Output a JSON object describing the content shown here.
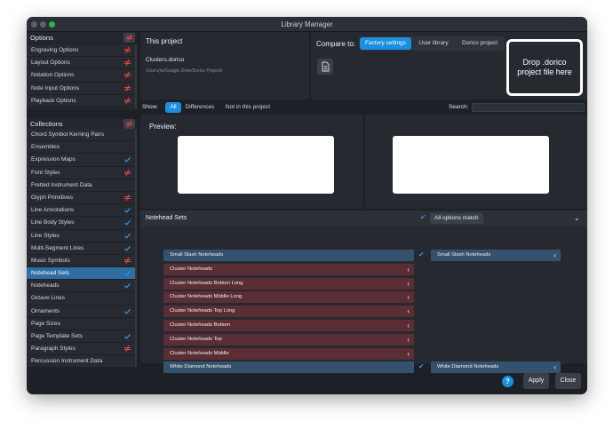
{
  "window": {
    "title": "Library Manager"
  },
  "options": {
    "title": "Options",
    "items": [
      {
        "label": "Engraving Options",
        "status": "diff"
      },
      {
        "label": "Layout Options",
        "status": "diff"
      },
      {
        "label": "Notation Options",
        "status": "diff"
      },
      {
        "label": "Note Input Options",
        "status": "diff"
      },
      {
        "label": "Playback Options",
        "status": "diff"
      }
    ]
  },
  "collections": {
    "title": "Collections",
    "items": [
      {
        "label": "Chord Symbol Kerning Pairs",
        "status": ""
      },
      {
        "label": "Ensembles",
        "status": ""
      },
      {
        "label": "Expression Maps",
        "status": "match"
      },
      {
        "label": "Font Styles",
        "status": "diff"
      },
      {
        "label": "Fretted Instrument Data",
        "status": ""
      },
      {
        "label": "Glyph Primitives",
        "status": "diff"
      },
      {
        "label": "Line Annotations",
        "status": "match"
      },
      {
        "label": "Line Body Styles",
        "status": "match"
      },
      {
        "label": "Line Styles",
        "status": "match"
      },
      {
        "label": "Multi-Segment Lines",
        "status": "match"
      },
      {
        "label": "Music Symbols",
        "status": "diff"
      },
      {
        "label": "Notehead Sets",
        "status": "match",
        "selected": true
      },
      {
        "label": "Noteheads",
        "status": "match"
      },
      {
        "label": "Octave Lines",
        "status": ""
      },
      {
        "label": "Ornaments",
        "status": "match"
      },
      {
        "label": "Page Sizes",
        "status": ""
      },
      {
        "label": "Page Template Sets",
        "status": "match"
      },
      {
        "label": "Paragraph Styles",
        "status": "diff"
      },
      {
        "label": "Percussion Instrument Data",
        "status": ""
      }
    ]
  },
  "project": {
    "title": "This project",
    "filename": "Clusters.dorico",
    "path": "/Users/jw/Google Drive/Dorico Projects"
  },
  "compare": {
    "label": "Compare to:",
    "options": [
      "Factory settings",
      "User library",
      "Dorico project"
    ],
    "active": 0
  },
  "drop": {
    "line1": "Drop .dorico",
    "line2": "project file here"
  },
  "filter": {
    "show_label": "Show:",
    "options": [
      "All",
      "Differences",
      "Not in this project"
    ],
    "active": 0,
    "search_label": "Search:",
    "search_value": ""
  },
  "preview": {
    "label": "Preview:"
  },
  "diff": {
    "section_title": "Notehead Sets",
    "match_label": "All options match",
    "left_items": [
      {
        "label": "Small Slash Noteheads",
        "kind": "blue",
        "tick": true
      },
      {
        "label": "Cluster Noteheads",
        "kind": "red",
        "tick": false
      },
      {
        "label": "Cluster Noteheads Bottom Long",
        "kind": "red",
        "tick": false
      },
      {
        "label": "Cluster Noteheads Middle Long",
        "kind": "red",
        "tick": false
      },
      {
        "label": "Cluster Noteheads Top Long",
        "kind": "red",
        "tick": false
      },
      {
        "label": "Cluster Noteheads Bottom",
        "kind": "red",
        "tick": false
      },
      {
        "label": "Cluster Noteheads Top",
        "kind": "red",
        "tick": false
      },
      {
        "label": "Cluster Noteheads Middle",
        "kind": "red",
        "tick": false
      },
      {
        "label": "White Diamond Noteheads",
        "kind": "blue",
        "tick": true
      }
    ],
    "right_items": [
      {
        "label": "Small Slash Noteheads",
        "row": 0
      },
      {
        "label": "White Diamond Noteheads",
        "row": 8
      }
    ]
  },
  "footer": {
    "help": "?",
    "apply": "Apply",
    "close": "Close"
  },
  "colors": {
    "accent": "#1a8fe0",
    "diff_mark": "#e2453c",
    "match_tick": "#2d8fe6"
  }
}
